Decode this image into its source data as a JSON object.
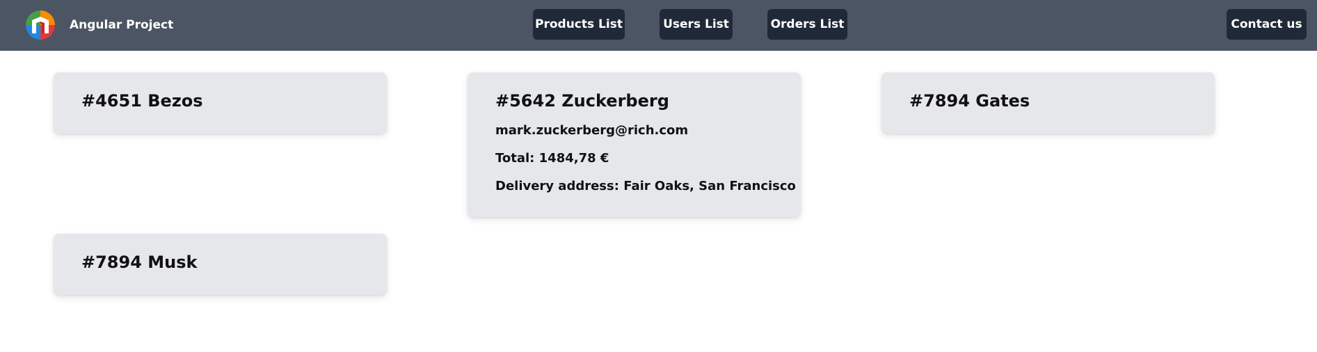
{
  "brand": {
    "title": "Angular Project",
    "logo_icon": "angular-project-logo-icon"
  },
  "nav": {
    "products_label": "Products List",
    "users_label": "Users List",
    "orders_label": "Orders List",
    "contact_label": "Contact us"
  },
  "colors": {
    "navbar_bg": "#4b5563",
    "nav_button_bg": "#1f2937",
    "card_bg": "#e5e7eb"
  },
  "orders": [
    {
      "title": "#4651 Bezos",
      "expanded": false
    },
    {
      "title": "#5642 Zuckerberg",
      "expanded": true,
      "email": "mark.zuckerberg@rich.com",
      "total": "Total: 1484,78 €",
      "address": "Delivery address: Fair Oaks, San Francisco"
    },
    {
      "title": "#7894 Gates",
      "expanded": false
    },
    {
      "title": "#7894 Musk",
      "expanded": false
    }
  ]
}
